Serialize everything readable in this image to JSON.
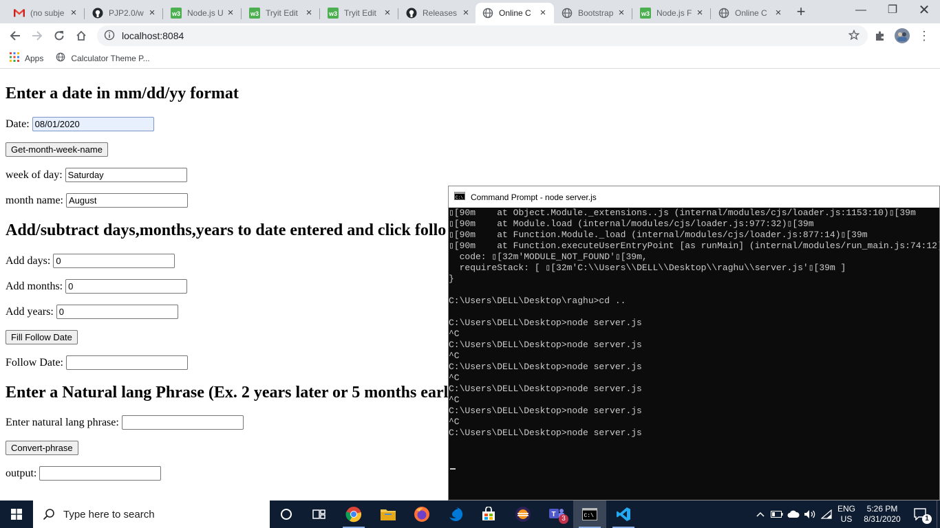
{
  "browser": {
    "tabs": [
      {
        "label": "(no subje",
        "icon": "gmail-icon"
      },
      {
        "label": "PJP2.0/w",
        "icon": "github-icon"
      },
      {
        "label": "Node.js U",
        "icon": "w3schools-icon"
      },
      {
        "label": "Tryit Edit",
        "icon": "w3schools-icon"
      },
      {
        "label": "Tryit Edit",
        "icon": "w3schools-icon"
      },
      {
        "label": "Releases",
        "icon": "github-icon"
      },
      {
        "label": "Online C",
        "icon": "globe-icon"
      },
      {
        "label": "Bootstrap",
        "icon": "globe-icon"
      },
      {
        "label": "Node.js F",
        "icon": "w3schools-icon"
      },
      {
        "label": "Online C",
        "icon": "globe-icon"
      }
    ],
    "active_tab_index": 6,
    "url": "localhost:8084",
    "bookmarks": [
      {
        "label": "Apps",
        "icon": "apps-grid-icon"
      },
      {
        "label": "Calculator Theme P...",
        "icon": "globe-icon"
      }
    ]
  },
  "page": {
    "section1": {
      "heading": "Enter a date in mm/dd/yy format",
      "date_label": "Date:",
      "date_value": "08/01/2020",
      "button": "Get-month-week-name",
      "week_label": "week of day:",
      "week_value": "Saturday",
      "month_label": "month name:",
      "month_value": "August"
    },
    "section2": {
      "heading": "Add/subtract days,months,years to date entered and click follo",
      "days_label": "Add days:",
      "days_value": "0",
      "months_label": "Add months:",
      "months_value": "0",
      "years_label": "Add years:",
      "years_value": "0",
      "button": "Fill Follow Date",
      "follow_label": "Follow Date:",
      "follow_value": ""
    },
    "section3": {
      "heading": "Enter a Natural lang Phrase (Ex. 2 years later or 5 months earl",
      "phrase_label": "Enter natural lang phrase:",
      "phrase_value": "",
      "button": "Convert-phrase",
      "output_label": "output:",
      "output_value": ""
    }
  },
  "cmd": {
    "title": "Command Prompt - node  server.js",
    "lines": [
      "▯[90m    at Object.Module._extensions..js (internal/modules/cjs/loader.js:1153:10)▯[39m",
      "▯[90m    at Module.load (internal/modules/cjs/loader.js:977:32)▯[39m",
      "▯[90m    at Function.Module._load (internal/modules/cjs/loader.js:877:14)▯[39m",
      "▯[90m    at Function.executeUserEntryPoint [as runMain] (internal/modules/run_main.js:74:12)",
      "  code: ▯[32m'MODULE_NOT_FOUND'▯[39m,",
      "  requireStack: [ ▯[32m'C:\\\\Users\\\\DELL\\\\Desktop\\\\raghu\\\\server.js'▯[39m ]",
      "}",
      "",
      "C:\\Users\\DELL\\Desktop\\raghu>cd ..",
      "",
      "C:\\Users\\DELL\\Desktop>node server.js",
      "^C",
      "C:\\Users\\DELL\\Desktop>node server.js",
      "^C",
      "C:\\Users\\DELL\\Desktop>node server.js",
      "^C",
      "C:\\Users\\DELL\\Desktop>node server.js",
      "^C",
      "C:\\Users\\DELL\\Desktop>node server.js",
      "^C",
      "C:\\Users\\DELL\\Desktop>node server.js"
    ]
  },
  "taskbar": {
    "search_placeholder": "Type here to search",
    "teams_badge": "3",
    "lang_top": "ENG",
    "lang_bottom": "US",
    "time": "5:26 PM",
    "date": "8/31/2020",
    "notification_count": "1"
  },
  "colors": {
    "accent": "#1a73e8",
    "taskbar": "#0f1d32",
    "cmd_bg": "#0c0c0c",
    "tabstrip": "#dee1e6"
  }
}
